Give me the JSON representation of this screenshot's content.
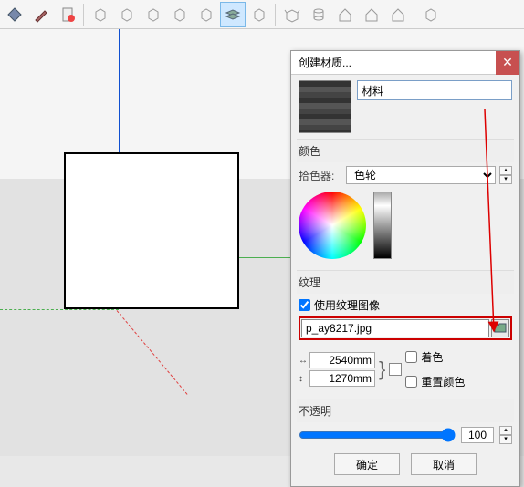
{
  "toolbar": {
    "icons": [
      "bucket",
      "brush",
      "info",
      "box1",
      "box2",
      "box3",
      "box4",
      "box5",
      "layers",
      "box6",
      "box7",
      "open",
      "house1",
      "house2",
      "house3",
      "box8"
    ]
  },
  "dialog": {
    "title": "创建材质...",
    "name_value": "材料",
    "color_section": "颜色",
    "picker_label": "拾色器:",
    "picker_value": "色轮",
    "texture_section": "纹理",
    "use_texture": "使用纹理图像",
    "file_value": "p_ay8217.jpg",
    "width_value": "2540mm",
    "height_value": "1270mm",
    "colorize": "着色",
    "reset_color": "重置颜色",
    "opacity_section": "不透明",
    "opacity_value": "100",
    "ok": "确定",
    "cancel": "取消"
  }
}
